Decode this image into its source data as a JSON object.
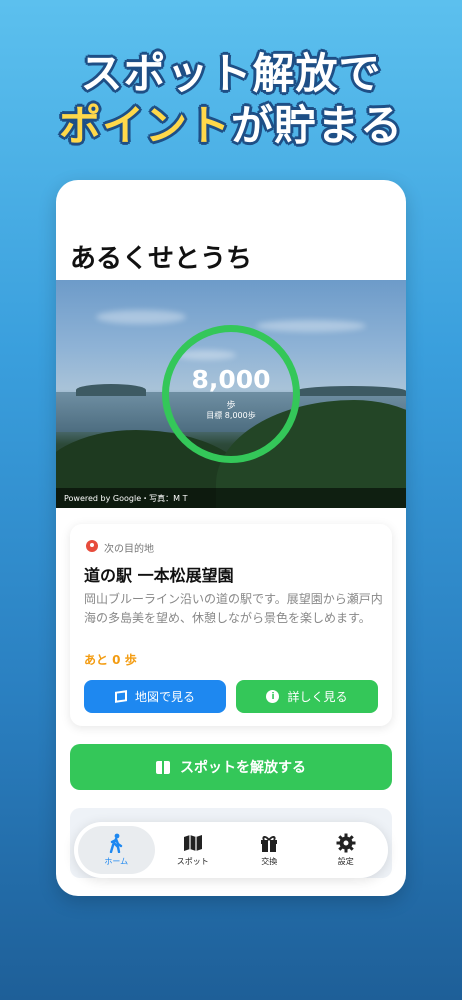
{
  "headline": {
    "line1": "スポット解放で",
    "line2_accent": "ポイント",
    "line2_rest": "が貯まる"
  },
  "app": {
    "title": "あるくせとうち"
  },
  "steps": {
    "value": "8,000",
    "unit": "歩",
    "goal": "目標 8,000歩",
    "progress_fraction": 1.0,
    "ring_color": "#34c759"
  },
  "photo_credit": "Powered by Google・写真：M T",
  "destination": {
    "label": "次の目的地",
    "name": "道の駅 一本松展望園",
    "description": "岡山ブルーライン沿いの道の駅です。展望園から瀬戸内海の多島美を望め、休憩しながら景色を楽しめます。",
    "remaining": "あと 0 歩",
    "map_button": "地図で見る",
    "detail_button": "詳しく見る"
  },
  "unlock_button": "スポットを解放する",
  "tabs": [
    {
      "label": "ホーム",
      "icon": "walking-icon",
      "active": true
    },
    {
      "label": "スポット",
      "icon": "map-icon",
      "active": false
    },
    {
      "label": "交換",
      "icon": "gift-icon",
      "active": false
    },
    {
      "label": "設定",
      "icon": "gear-icon",
      "active": false
    }
  ],
  "colors": {
    "accent_blue": "#1e88f0",
    "accent_green": "#34c759",
    "remaining_orange": "#f39c12",
    "headline_yellow": "#ffd84a"
  }
}
